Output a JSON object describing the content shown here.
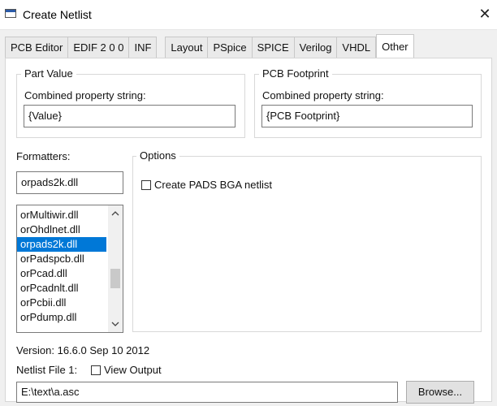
{
  "window": {
    "title": "Create Netlist",
    "close_glyph": "✕"
  },
  "tabs": [
    {
      "label": "PCB Editor",
      "active": false
    },
    {
      "label": "EDIF 2 0 0",
      "active": false
    },
    {
      "label": "INF",
      "active": false
    },
    {
      "label": "Layout",
      "active": false
    },
    {
      "label": "PSpice",
      "active": false
    },
    {
      "label": "SPICE",
      "active": false
    },
    {
      "label": "Verilog",
      "active": false
    },
    {
      "label": "VHDL",
      "active": false
    },
    {
      "label": "Other",
      "active": true
    }
  ],
  "part_value": {
    "legend": "Part Value",
    "label": "Combined property string:",
    "value": "{Value}"
  },
  "pcb_footprint": {
    "legend": "PCB Footprint",
    "label": "Combined property string:",
    "value": "{PCB Footprint}"
  },
  "formatters": {
    "label": "Formatters:",
    "selected_value": "orpads2k.dll",
    "items": [
      {
        "label": "orMultiwir.dll",
        "selected": false
      },
      {
        "label": "orOhdlnet.dll",
        "selected": false
      },
      {
        "label": "orpads2k.dll",
        "selected": true
      },
      {
        "label": "orPadspcb.dll",
        "selected": false
      },
      {
        "label": "orPcad.dll",
        "selected": false
      },
      {
        "label": "orPcadnlt.dll",
        "selected": false
      },
      {
        "label": "orPcbii.dll",
        "selected": false
      },
      {
        "label": "orPdump.dll",
        "selected": false
      }
    ]
  },
  "options": {
    "legend": "Options",
    "checkbox_label": "Create PADS BGA netlist",
    "checked": false
  },
  "version_text": "Version: 16.6.0  Sep 10 2012",
  "netlist_file": {
    "label": "Netlist File 1:",
    "view_output_label": "View Output",
    "view_output_checked": false,
    "path": "E:\\text\\a.asc",
    "browse_label": "Browse..."
  },
  "icons": {
    "window": "netlist-window-icon",
    "close": "close-icon",
    "scroll_up": "chevron-up-icon",
    "scroll_down": "chevron-down-icon"
  }
}
